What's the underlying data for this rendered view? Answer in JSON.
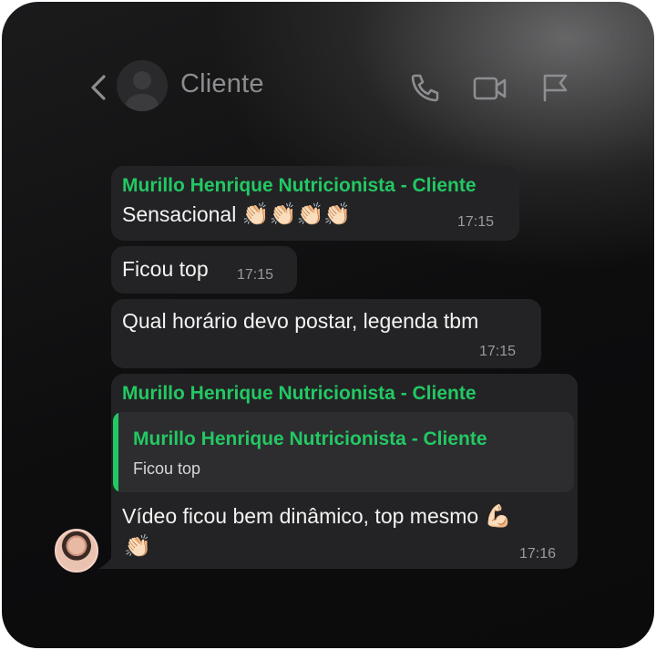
{
  "header": {
    "title": "Cliente",
    "icons": [
      "back-chevron-icon",
      "profile-avatar-icon",
      "phone-icon",
      "video-camera-icon",
      "flag-icon"
    ]
  },
  "messages": [
    {
      "sender": "Murillo Henrique Nutricionista - Cliente",
      "text": "Sensacional",
      "emoji": "👏🏻👏🏻👏🏻👏🏻",
      "time": "17:15"
    },
    {
      "text": "Ficou top",
      "time": "17:15"
    },
    {
      "text": "Qual horário devo postar, legenda tbm",
      "time": "17:15"
    },
    {
      "sender": "Murillo Henrique Nutricionista - Cliente",
      "quote": {
        "sender": "Murillo Henrique Nutricionista - Cliente",
        "text": "Ficou top"
      },
      "text": "Vídeo ficou bem dinâmico, top mesmo",
      "emoji_inline": "💪🏻",
      "emoji_line2": "👏🏻",
      "time": "17:16"
    }
  ],
  "colors": {
    "accent_green": "#23c863",
    "bubble_bg": "#232325",
    "quote_bg": "#2d2d30"
  }
}
